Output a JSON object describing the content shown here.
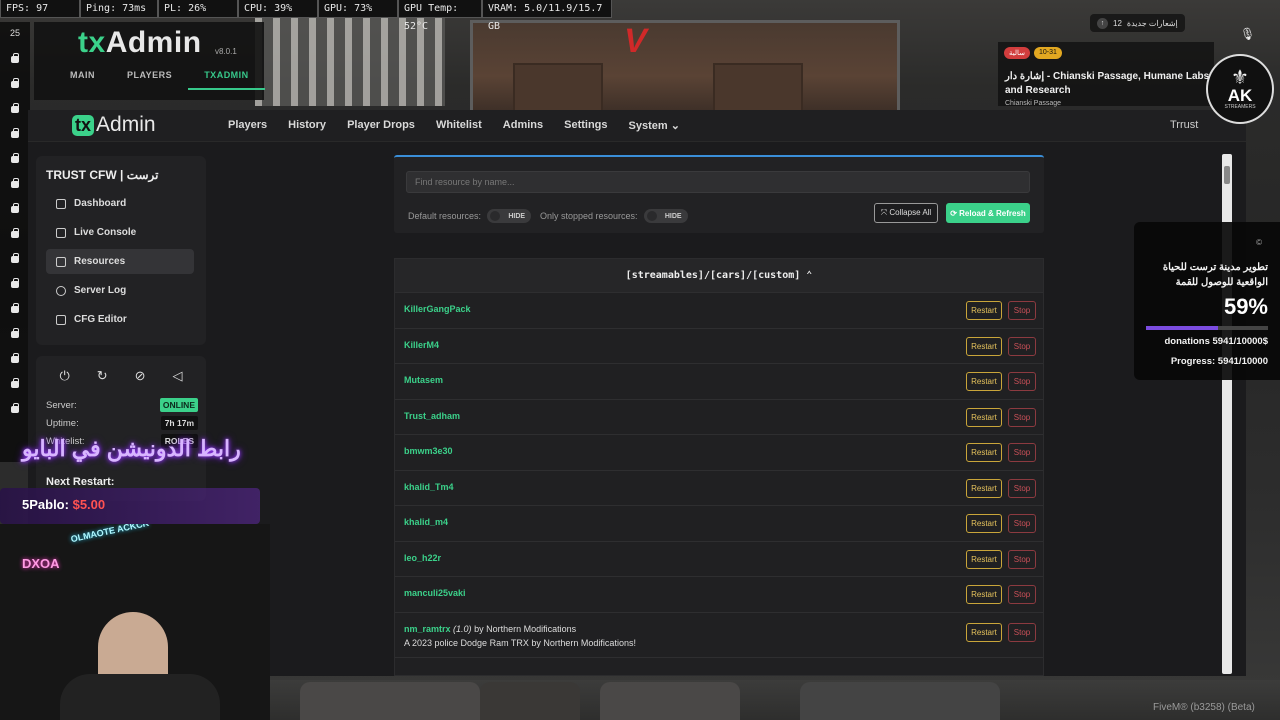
{
  "perf": [
    "FPS: 97",
    "Ping: 73ms",
    "PL: 26%",
    "CPU: 39%",
    "GPU: 73%",
    "GPU Temp: 52°C",
    "VRAM: 5.0/11.9/15.7 GB"
  ],
  "left_strip": {
    "number": "25"
  },
  "ingame_menu": {
    "logo_tx": "tx",
    "logo_admin": "Admin",
    "version": "v8.0.1",
    "tabs": [
      "MAIN",
      "PLAYERS",
      "TXADMIN"
    ]
  },
  "topnav": {
    "brand_tx": "tx",
    "brand_admin": "Admin",
    "links": [
      "Players",
      "History",
      "Player Drops",
      "Whitelist",
      "Admins",
      "Settings",
      "System ⌄"
    ],
    "user": "Trrust"
  },
  "sidebar": {
    "server_name": "TRUST CFW | ترست",
    "items": [
      "Dashboard",
      "Live Console",
      "Resources",
      "Server Log",
      "CFG Editor"
    ],
    "active": "Resources"
  },
  "status": {
    "server_label": "Server:",
    "server_value": "ONLINE",
    "uptime_label": "Uptime:",
    "uptime_value": "7h 17m",
    "whitelist_label": "Whitelist:",
    "whitelist_value": "ROLES",
    "next_restart_label": "Next Restart:"
  },
  "search": {
    "placeholder": "Find resource by name...",
    "default_label": "Default resources:",
    "default_toggle": "HIDE",
    "stopped_label": "Only stopped resources:",
    "stopped_toggle": "HIDE",
    "collapse_label": "⤧ Collapse All",
    "reload_label": "⟳ Reload & Refresh"
  },
  "resources": {
    "group": "[streamables]/[cars]/[custom] ⌃",
    "restart_label": "Restart",
    "stop_label": "Stop",
    "items": [
      {
        "name": "KillerGangPack"
      },
      {
        "name": "KillerM4"
      },
      {
        "name": "Mutasem"
      },
      {
        "name": "Trust_adham"
      },
      {
        "name": "bmwm3e30"
      },
      {
        "name": "khalid_Tm4"
      },
      {
        "name": "khalid_m4"
      },
      {
        "name": "leo_h22r"
      },
      {
        "name": "manculi25vaki"
      },
      {
        "name": "nm_ramtrx",
        "version": "(1.0)",
        "author": "by Northern Modifications",
        "description": "A 2023 police Dodge Ram TRX by Northern Modifications!"
      }
    ]
  },
  "overlay": {
    "notif_count": "12",
    "notif_text": "إشعارات جديدة",
    "location_tag_red": "سالية",
    "location_tag_yellow": "10-31",
    "location_name": "إشارة دار - Chianski Passage, Humane Labs and Research",
    "location_sub": "Chianski Passage",
    "ak_logo_text": "AK",
    "ak_logo_sub": "STREAMERS",
    "donation_title": "تطوير مدينة ترست للحياة الواقعية للوصول للقمة",
    "donation_percent": "59%",
    "donation_progress": 0.5941,
    "donation_line1": "donations 5941/10000$",
    "donation_line2": "Progress: 5941/10000",
    "arabic_banner": "رابط الدونيشن في البايو",
    "alert_name": "5Pablo:",
    "alert_amount": "$5.00",
    "cam_neon1": "DXOA",
    "cam_neon2": "OLMAOTE ACKCK",
    "fivem_version": "FiveM® (b3258) (Beta)"
  },
  "colors": {
    "accent": "#3bd18a",
    "restart": "#e5c25c",
    "stop": "#c95058",
    "search_border": "#3a8ed8"
  }
}
